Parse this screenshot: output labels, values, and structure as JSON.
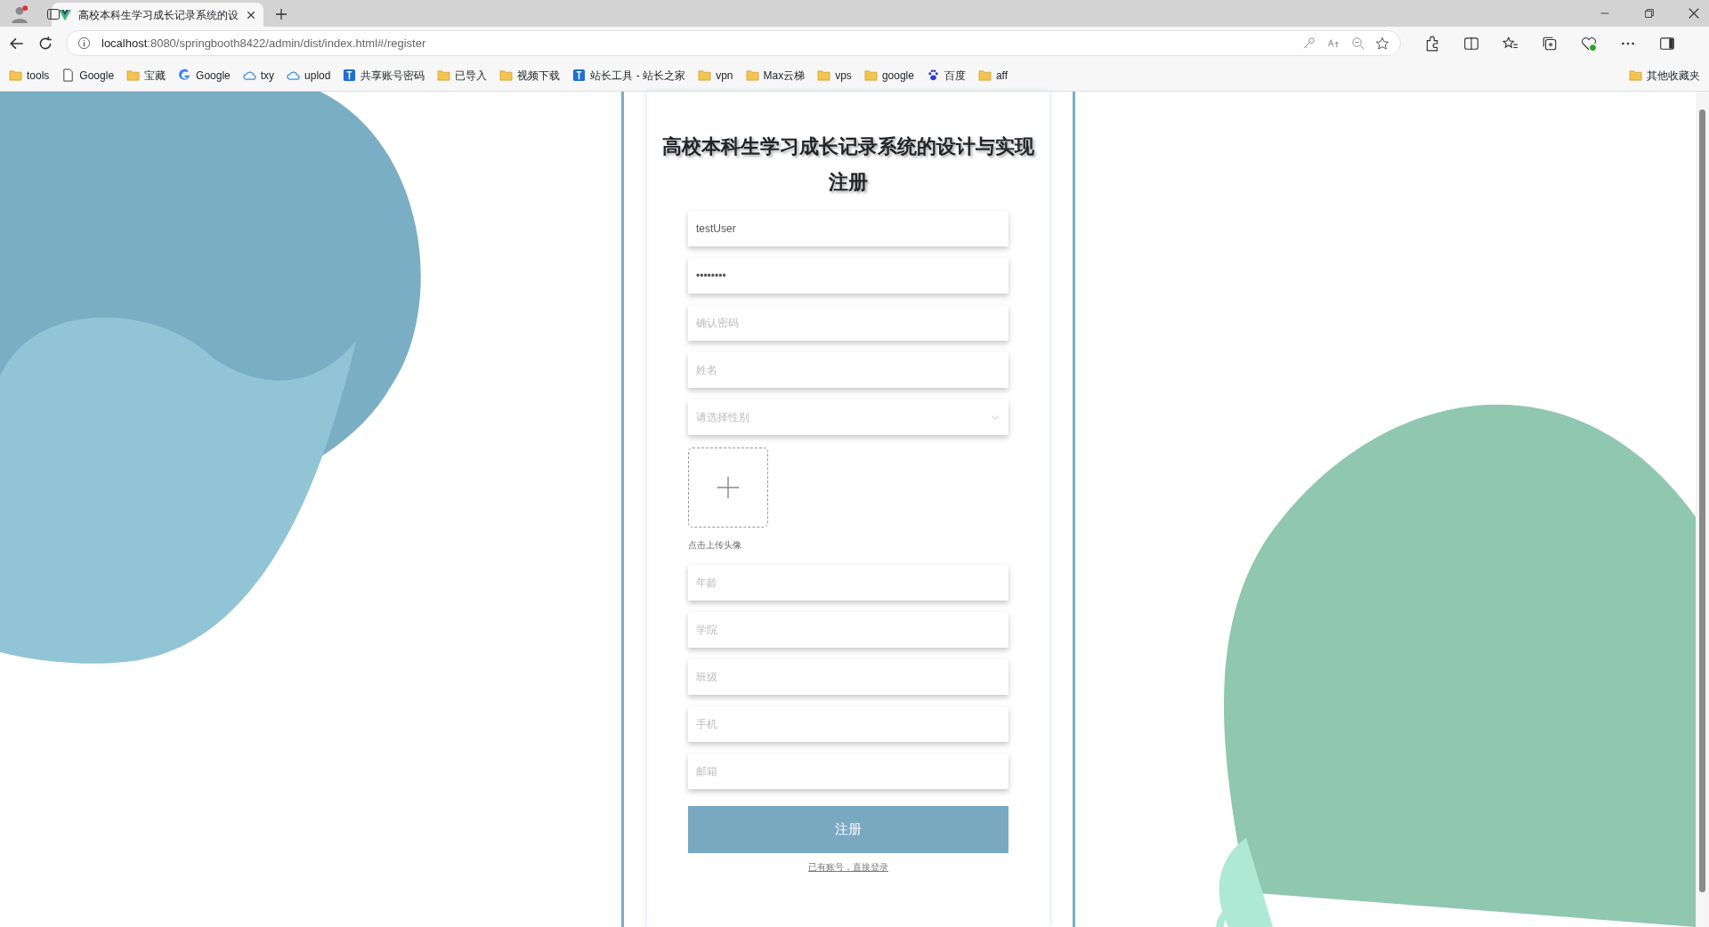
{
  "browser": {
    "tabs": [
      {
        "title": "高校本科生学习成长记录系统的设",
        "selected": true
      }
    ],
    "address": {
      "host": "localhost",
      "path": ":8080/springbooth8422/admin/dist/index.html#/register"
    },
    "bookmarks": [
      {
        "kind": "folder",
        "label": "tools"
      },
      {
        "kind": "page",
        "label": "Google"
      },
      {
        "kind": "folder",
        "label": "宝藏"
      },
      {
        "kind": "google",
        "label": "Google"
      },
      {
        "kind": "cloud",
        "label": "txy"
      },
      {
        "kind": "cloud",
        "label": "uplod"
      },
      {
        "kind": "site",
        "label": "共享账号密码"
      },
      {
        "kind": "folder",
        "label": "已导入"
      },
      {
        "kind": "folder",
        "label": "视频下载"
      },
      {
        "kind": "site",
        "label": "站长工具 - 站长之家"
      },
      {
        "kind": "folder",
        "label": "vpn"
      },
      {
        "kind": "folder",
        "label": "Max云梯"
      },
      {
        "kind": "folder",
        "label": "vps"
      },
      {
        "kind": "folder",
        "label": "google"
      },
      {
        "kind": "paw",
        "label": "百度"
      },
      {
        "kind": "folder",
        "label": "aff"
      }
    ],
    "other_bookmarks": "其他收藏夹"
  },
  "form": {
    "title": "高校本科生学习成长记录系统的设计与实现",
    "subtitle": "注册",
    "fields": [
      {
        "kind": "text",
        "value": "testUser"
      },
      {
        "kind": "text",
        "value": "••••••••"
      },
      {
        "kind": "text",
        "placeholder": "确认密码"
      },
      {
        "kind": "text",
        "placeholder": "姓名"
      },
      {
        "kind": "select",
        "placeholder": "请选择性别"
      },
      {
        "kind": "upload",
        "caption": "点击上传头像"
      },
      {
        "kind": "text",
        "placeholder": "年龄"
      },
      {
        "kind": "text",
        "placeholder": "学院"
      },
      {
        "kind": "text",
        "placeholder": "班级"
      },
      {
        "kind": "text",
        "placeholder": "手机"
      },
      {
        "kind": "text",
        "placeholder": "邮箱"
      }
    ],
    "submit": "注册",
    "login_link": "已有账号，直接登录"
  }
}
